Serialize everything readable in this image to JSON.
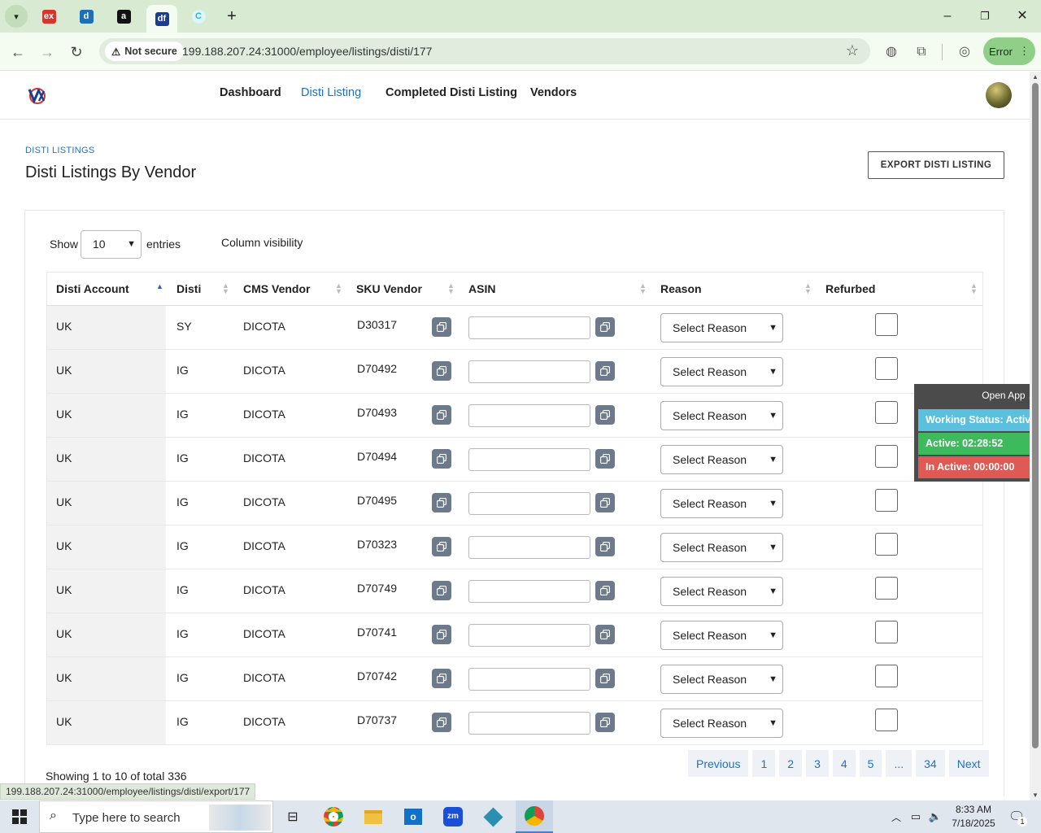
{
  "browser": {
    "url": "199.188.207.24:31000/employee/listings/disti/177",
    "security_label": "Not secure",
    "error_label": "Error",
    "status_url": "199.188.207.24:31000/employee/listings/disti/export/177"
  },
  "nav": {
    "items": [
      {
        "label": "Dashboard"
      },
      {
        "label": "Disti Listing"
      },
      {
        "label": "Completed Disti Listing"
      },
      {
        "label": "Vendors"
      }
    ],
    "active": "Disti Listing"
  },
  "page": {
    "breadcrumb": "DISTI LISTINGS",
    "title": "Disti Listings By Vendor",
    "export_label": "EXPORT DISTI LISTING"
  },
  "controls": {
    "show_label": "Show",
    "entries_value": "10",
    "entries_label": "entries",
    "column_visibility": "Column visibility"
  },
  "table": {
    "headers": [
      "Disti Account",
      "Disti",
      "CMS Vendor",
      "SKU Vendor",
      "ASIN",
      "Reason",
      "Refurbed"
    ],
    "reason_placeholder": "Select Reason",
    "rows": [
      {
        "account": "UK",
        "disti": "SY",
        "vendor": "DICOTA",
        "sku": "D30317"
      },
      {
        "account": "UK",
        "disti": "IG",
        "vendor": "DICOTA",
        "sku": "D70492"
      },
      {
        "account": "UK",
        "disti": "IG",
        "vendor": "DICOTA",
        "sku": "D70493"
      },
      {
        "account": "UK",
        "disti": "IG",
        "vendor": "DICOTA",
        "sku": "D70494"
      },
      {
        "account": "UK",
        "disti": "IG",
        "vendor": "DICOTA",
        "sku": "D70495"
      },
      {
        "account": "UK",
        "disti": "IG",
        "vendor": "DICOTA",
        "sku": "D70323"
      },
      {
        "account": "UK",
        "disti": "IG",
        "vendor": "DICOTA",
        "sku": "D70749"
      },
      {
        "account": "UK",
        "disti": "IG",
        "vendor": "DICOTA",
        "sku": "D70741"
      },
      {
        "account": "UK",
        "disti": "IG",
        "vendor": "DICOTA",
        "sku": "D70742"
      },
      {
        "account": "UK",
        "disti": "IG",
        "vendor": "DICOTA",
        "sku": "D70737"
      }
    ]
  },
  "pagination": {
    "info": "Showing 1 to 10 of total 336",
    "previous": "Previous",
    "pages": [
      "1",
      "2",
      "3",
      "4",
      "5",
      "...",
      "34"
    ],
    "next": "Next"
  },
  "widget": {
    "open_app": "Open App ↗",
    "working_status": "Working Status: Active",
    "active": "Active: 02:28:52",
    "inactive": "In Active: 00:00:00",
    "colors": {
      "working": "#5bc0de",
      "active": "#3dbb5c",
      "inactive": "#e05a55"
    }
  },
  "taskbar": {
    "search_placeholder": "Type here to search",
    "time": "8:33 AM",
    "date": "7/18/2025",
    "notification_count": "1"
  }
}
